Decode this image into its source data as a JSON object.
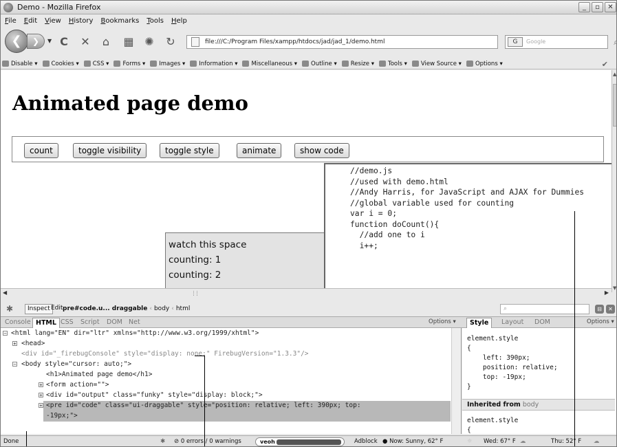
{
  "window": {
    "title": "Demo - Mozilla Firefox"
  },
  "menu": [
    "File",
    "Edit",
    "View",
    "History",
    "Bookmarks",
    "Tools",
    "Help"
  ],
  "address": {
    "url": "file:///C:/Program Files/xampp/htdocs/jad/jad_1/demo.html",
    "search_placeholder": "Google",
    "search_engine": "G"
  },
  "devbar": [
    "Disable",
    "Cookies",
    "CSS",
    "Forms",
    "Images",
    "Information",
    "Miscellaneous",
    "Outline",
    "Resize",
    "Tools",
    "View Source",
    "Options"
  ],
  "page": {
    "heading": "Animated page demo",
    "buttons": [
      "count",
      "toggle visibility",
      "toggle style",
      "animate",
      "show code"
    ],
    "output_lines": [
      "watch this space",
      "counting: 1",
      "counting: 2"
    ],
    "code_lines": [
      "//demo.js",
      "//used with demo.html",
      "//Andy Harris, for JavaScript and AJAX for Dummies",
      "",
      "//global variable used for counting",
      "var i = 0;",
      "",
      "function doCount(){",
      "  //add one to i",
      "  i++;"
    ]
  },
  "firebug": {
    "inspect": "Inspect",
    "edit": "Edit",
    "breadcrumb": {
      "current": "pre#code.u... draggable",
      "p1": "body",
      "p2": "html"
    },
    "tabs": [
      "Console",
      "HTML",
      "CSS",
      "Script",
      "DOM",
      "Net"
    ],
    "active_tab": "HTML",
    "options": "Options",
    "side_tabs": [
      "Style",
      "Layout",
      "DOM"
    ],
    "active_side_tab": "Style",
    "side_options": "Options",
    "html_lines": [
      "<html lang=\"EN\" dir=\"ltr\" xmlns=\"http://www.w3.org/1999/xhtml\">",
      "<head>",
      "<div id=\"_firebugConsole\" style=\"display: none;\" FirebugVersion=\"1.3.3\"/>",
      "<body style=\"cursor: auto;\">",
      "<h1>Animated page demo</h1>",
      "<form action=\"\">",
      "<div id=\"output\" class=\"funky\" style=\"display: block;\">",
      "<pre id=\"code\" class=\"ui-draggable\" style=\"position: relative; left: 390px; top:",
      "-19px;\">"
    ],
    "style_block": [
      "element.style",
      "{",
      "    left: 390px;",
      "    position: relative;",
      "    top: -19px;",
      "}"
    ],
    "inherited_label": "Inherited from",
    "inherited_from": "body",
    "style_block2": [
      "element.style",
      "{"
    ]
  },
  "status": {
    "done": "Done",
    "errors": "0 errors / 0 warnings",
    "veoh": "veoh",
    "adblock": "Adblock",
    "weather_now": "Now: Sunny, 62° F",
    "wed": "Wed: 67° F",
    "thu": "Thu: 52° F"
  }
}
